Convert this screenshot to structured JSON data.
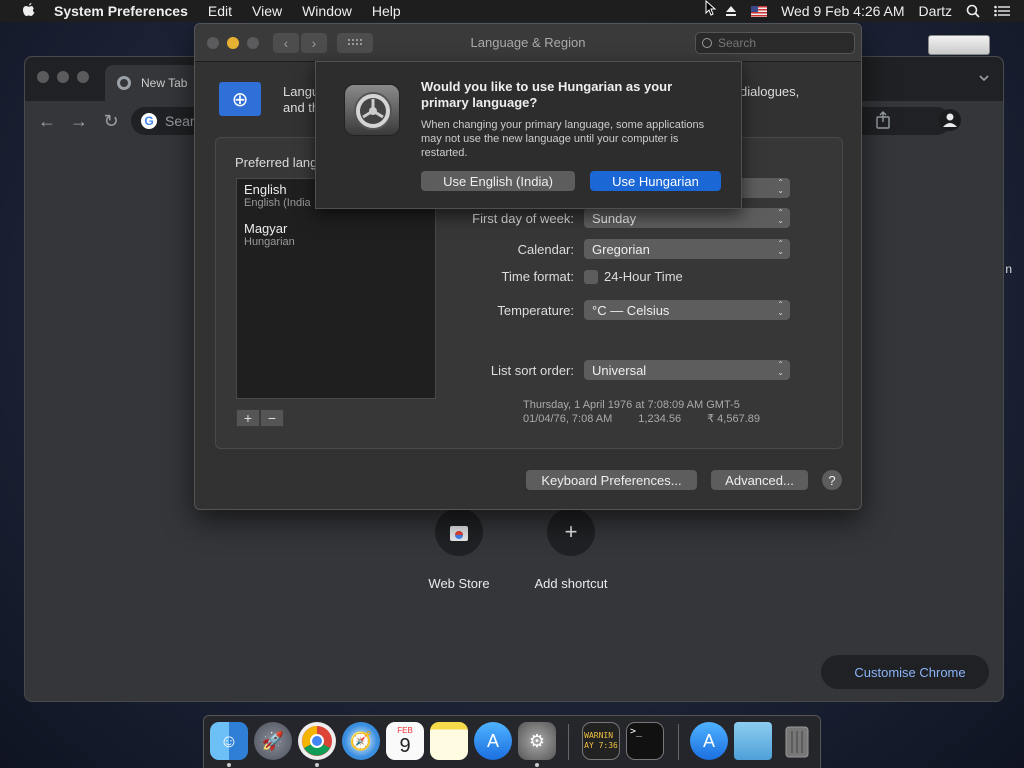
{
  "menubar": {
    "app_name": "System Preferences",
    "menus": [
      "Edit",
      "View",
      "Window",
      "Help"
    ],
    "datetime": "Wed 9 Feb  4:26 AM",
    "user": "Dartz"
  },
  "chrome": {
    "tab_title": "New Tab",
    "omnibox_placeholder": "Sear",
    "shortcuts": [
      {
        "label": "Web Store"
      },
      {
        "label": "Add shortcut"
      }
    ],
    "customise_label": "Customise Chrome",
    "right_edge_fragment": "n"
  },
  "prefs": {
    "window_title": "Language & Region",
    "search_placeholder": "Search",
    "header_line1": "Langu",
    "header_line2": "and th",
    "header_right": "dialogues,",
    "preferred_label": "Preferred lang",
    "languages": [
      {
        "name": "English",
        "sub": "English (India"
      },
      {
        "name": "Magyar",
        "sub": "Hungarian"
      }
    ],
    "add_label": "+",
    "remove_label": "−",
    "settings": {
      "first_day_label": "First day of week:",
      "first_day_value": "Sunday",
      "calendar_label": "Calendar:",
      "calendar_value": "Gregorian",
      "time_format_label": "Time format:",
      "time_format_value": "24-Hour Time",
      "temperature_label": "Temperature:",
      "temperature_value": "°C — Celsius",
      "sort_label": "List sort order:",
      "sort_value": "Universal"
    },
    "sample_line1": "Thursday, 1 April 1976 at 7:08:09 AM GMT-5",
    "sample_date": "01/04/76, 7:08 AM",
    "sample_number": "1,234.56",
    "sample_currency": "₹ 4,567.89",
    "keyboard_button": "Keyboard Preferences...",
    "advanced_button": "Advanced...",
    "help_button": "?"
  },
  "sheet": {
    "title": "Would you like to use Hungarian as your primary language?",
    "body": "When changing your primary language, some applications may not use the new language until your computer is restarted.",
    "secondary_button": "Use English (India)",
    "primary_button": "Use Hungarian"
  },
  "dock": {
    "console_text": "WARNIN\nAY 7:36",
    "calendar_month": "FEB",
    "calendar_day": "9"
  },
  "colors": {
    "accent": "#1b67d6",
    "link": "#8ab4f8"
  }
}
